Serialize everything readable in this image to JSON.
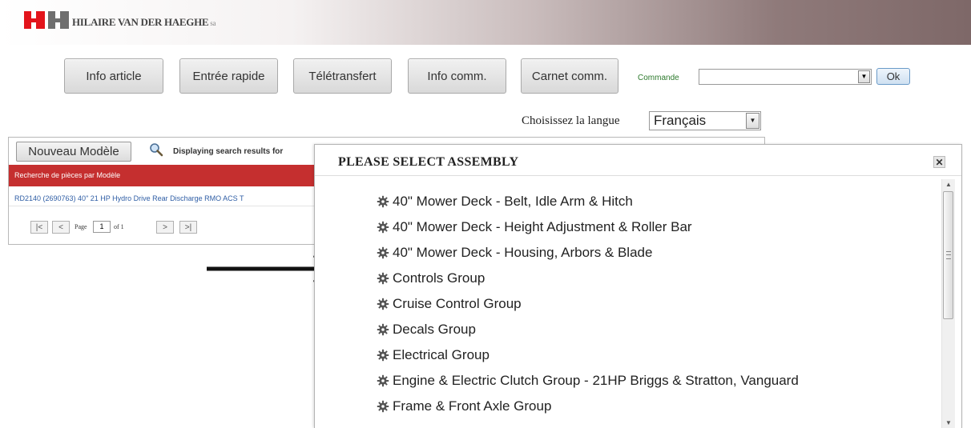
{
  "header": {
    "brand": "HILAIRE VAN DER HAEGHE",
    "brand_suffix": "sa"
  },
  "nav": {
    "buttons": [
      "Info article",
      "Entrée rapide",
      "Télétransfert",
      "Info comm.",
      "Carnet comm."
    ],
    "commande_label": "Commande",
    "commande_value": "",
    "ok_label": "Ok"
  },
  "language": {
    "label": "Choisissez la langue",
    "selected": "Français"
  },
  "search": {
    "new_model_button": "Nouveau Modèle",
    "displaying_text": "Displaying search results for",
    "section_title": "Recherche de pièces par Modèle",
    "model_row": "RD2140 (2690763) 40\" 21 HP Hydro Drive Rear Discharge RMO ACS T",
    "pager": {
      "first": "|<",
      "prev": "<",
      "page_label": "Page",
      "current_page": "1",
      "of_label": "of 1",
      "next": ">",
      "last": ">|"
    }
  },
  "modal": {
    "title": "PLEASE SELECT ASSEMBLY",
    "close_icon": "close-icon",
    "items": [
      "40\" Mower Deck - Belt, Idle Arm & Hitch",
      "40\" Mower Deck - Height Adjustment & Roller Bar",
      "40\" Mower Deck - Housing, Arbors & Blade",
      "Controls Group",
      "Cruise Control Group",
      "Decals Group",
      "Electrical Group",
      "Engine & Electric Clutch Group - 21HP Briggs & Stratton, Vanguard",
      "Frame & Front Axle Group"
    ]
  },
  "colors": {
    "accent_red": "#c52f2f",
    "link_blue": "#2f5ea5",
    "commande_green": "#2d7a2d"
  }
}
